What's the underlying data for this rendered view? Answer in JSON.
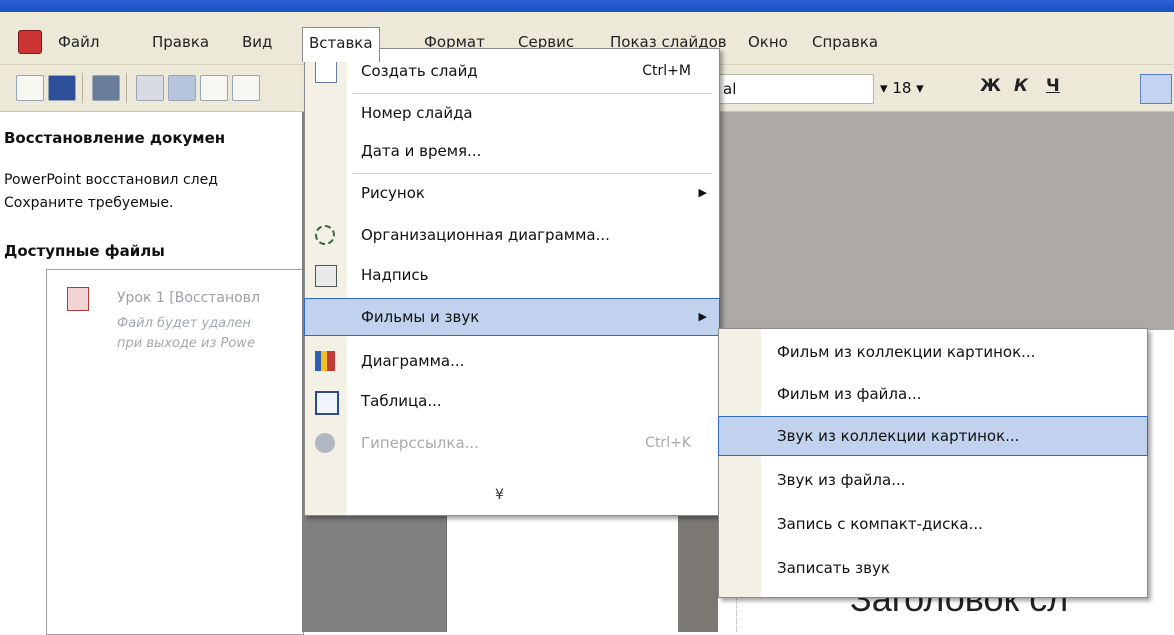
{
  "menubar": {
    "items": [
      "Файл",
      "Правка",
      "Вид",
      "Вставка",
      "Формат",
      "Сервис",
      "Показ слайдов",
      "Окно",
      "Справка"
    ]
  },
  "toolbar": {
    "font_name": "al",
    "font_size": "18",
    "bold": "Ж",
    "italic": "К",
    "underline": "Ч"
  },
  "taskpane": {
    "title": "Восстановление докумен",
    "desc_line1": "PowerPoint восстановил след",
    "desc_line2": "Сохраните требуемые.",
    "available_files": "Доступные файлы",
    "file_title": "Урок 1 [Восстановл",
    "file_note_line1": "Файл будет удален",
    "file_note_line2": "при выходе из Powe"
  },
  "insert_menu": {
    "items": [
      {
        "label": "Создать слайд",
        "shortcut": "Ctrl+M",
        "icon": "new-slide-icon"
      },
      {
        "label": "Номер слайда"
      },
      {
        "label": "Дата и время..."
      },
      {
        "label": "Рисунок",
        "submenu": true
      },
      {
        "label": "Организационная диаграмма...",
        "icon": "org-chart-icon"
      },
      {
        "label": "Надпись",
        "icon": "text-box-icon"
      },
      {
        "label": "Фильмы и звук",
        "submenu": true
      },
      {
        "label": "Диаграмма...",
        "icon": "chart-icon"
      },
      {
        "label": "Таблица...",
        "icon": "table-icon"
      },
      {
        "label": "Гиперссылка...",
        "shortcut": "Ctrl+K",
        "icon": "hyperlink-icon",
        "disabled": true
      }
    ],
    "expand": "¥"
  },
  "media_submenu": {
    "items": [
      "Фильм из коллекции картинок...",
      "Фильм из файла...",
      "Звук из коллекции картинок...",
      "Звук из файла...",
      "Запись с компакт-диска...",
      "Записать звук"
    ],
    "highlighted": 2
  },
  "slide": {
    "title_placeholder": "Заголовок сл"
  },
  "colors": {
    "menu_bg": "#ece9d8",
    "highlight": "#c1d2ee",
    "highlight_border": "#316ac5",
    "title_bar": "#1c4fc0"
  }
}
